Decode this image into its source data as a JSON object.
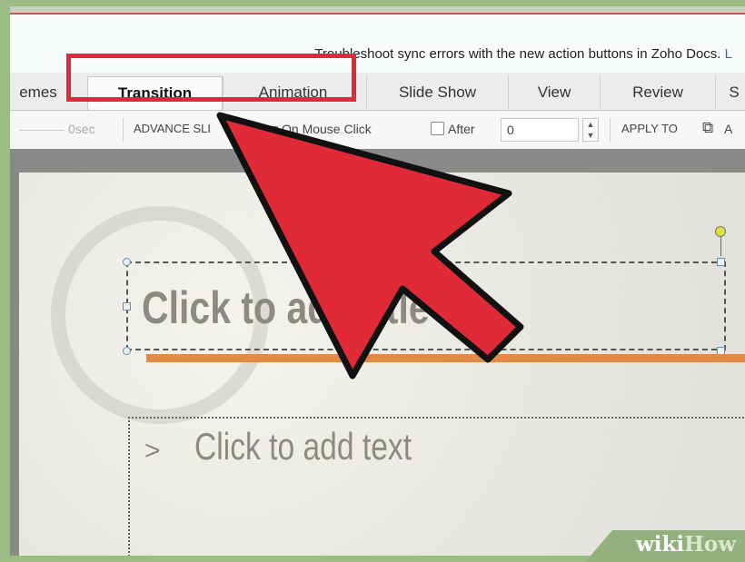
{
  "notice": {
    "text": "Troubleshoot sync errors with the new action buttons in Zoho Docs.",
    "link": "L"
  },
  "tabs": [
    {
      "label": "emes",
      "active": false
    },
    {
      "label": "Transition",
      "active": true
    },
    {
      "label": "Animation",
      "active": false
    },
    {
      "label": "Slide Show",
      "active": false
    },
    {
      "label": "View",
      "active": false
    },
    {
      "label": "Review",
      "active": false
    },
    {
      "label": "S",
      "active": false
    }
  ],
  "toolbar": {
    "duration": "0sec",
    "advance_slide": "ADVANCE SLI",
    "on_mouse_click": "On Mouse Click",
    "on_mouse_click_checked": true,
    "after": "After",
    "after_checked": false,
    "after_value": "0",
    "apply_to": "APPLY TO",
    "apply_icon": "copy-slides-icon",
    "apply_cut": "A"
  },
  "slide": {
    "title_placeholder": "Click to add title",
    "body_bullet": ">",
    "body_placeholder": "Click to add text"
  },
  "overlay": {
    "highlight_color": "#e02a37",
    "arrow_color": "#e02a37"
  },
  "watermark": {
    "wiki": "wiki",
    "how": "How"
  }
}
